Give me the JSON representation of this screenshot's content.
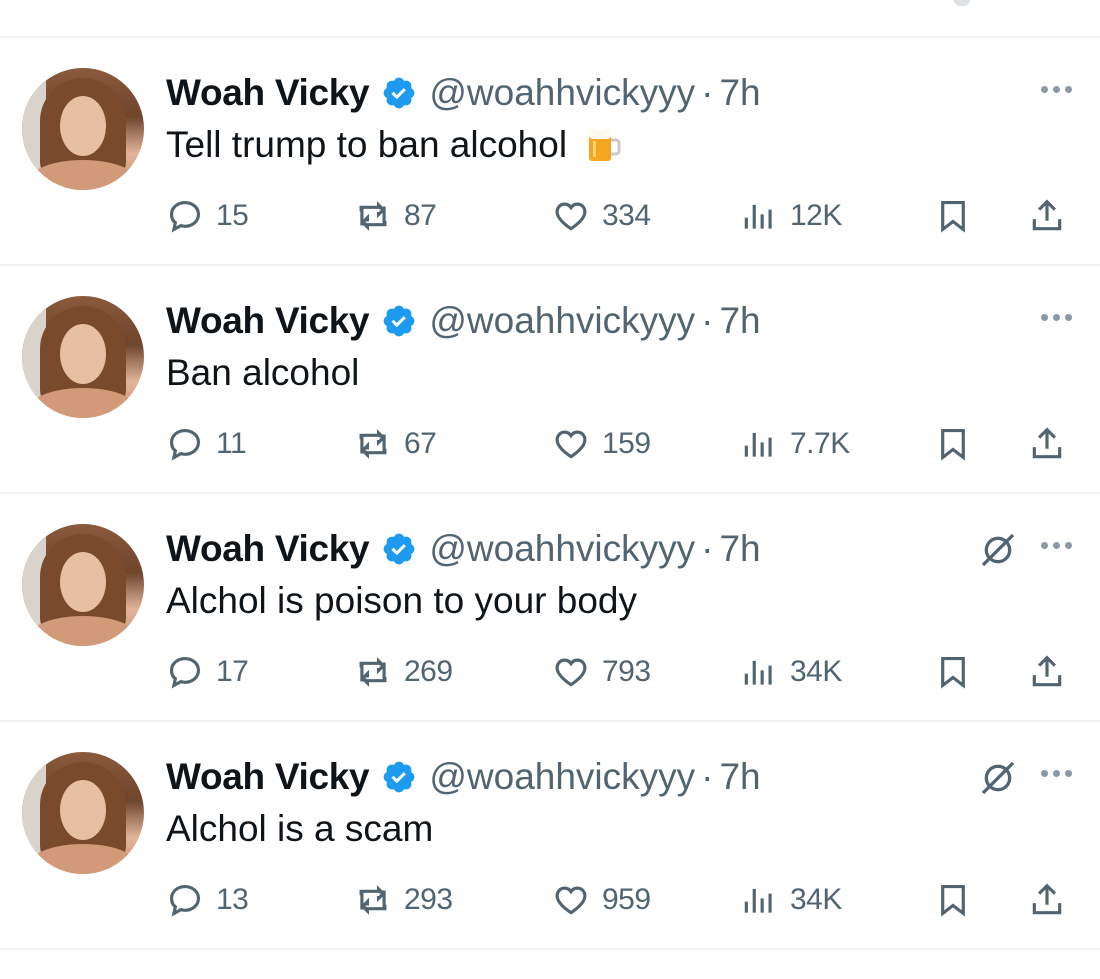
{
  "tweets": [
    {
      "name": "Woah Vicky",
      "handle": "@woahhvickyyy",
      "separator": "·",
      "time": "7h",
      "text": "Tell trump to ban alcohol",
      "emoji": "beer-mug-icon",
      "muted_icon": false,
      "replies": "15",
      "retweets": "87",
      "likes": "334",
      "views": "12K"
    },
    {
      "name": "Woah Vicky",
      "handle": "@woahhvickyyy",
      "separator": "·",
      "time": "7h",
      "text": "Ban alcohol",
      "muted_icon": false,
      "replies": "11",
      "retweets": "67",
      "likes": "159",
      "views": "7.7K"
    },
    {
      "name": "Woah Vicky",
      "handle": "@woahhvickyyy",
      "separator": "·",
      "time": "7h",
      "text": "Alchol is poison to your body",
      "muted_icon": true,
      "replies": "17",
      "retweets": "269",
      "likes": "793",
      "views": "34K"
    },
    {
      "name": "Woah Vicky",
      "handle": "@woahhvickyyy",
      "separator": "·",
      "time": "7h",
      "text": "Alchol is a scam",
      "muted_icon": true,
      "replies": "13",
      "retweets": "293",
      "likes": "959",
      "views": "34K"
    }
  ],
  "colors": {
    "verified": "#1d9bf0",
    "secondary_text": "#536471",
    "divider": "#eff3f4"
  }
}
